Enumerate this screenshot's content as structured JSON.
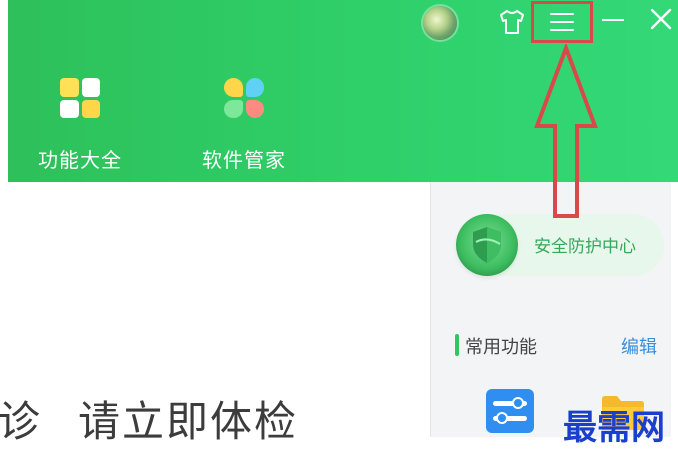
{
  "titlebar": {
    "icons": [
      "avatar",
      "skin-icon",
      "menu-icon",
      "minimize-icon",
      "close-icon"
    ]
  },
  "toolbar": {
    "items": [
      {
        "label": "功能大全",
        "icon": "apps-grid-icon",
        "colors": [
          "#ffe156",
          "#ffffff",
          "#ffffff",
          "#ffd54a"
        ]
      },
      {
        "label": "软件管家",
        "icon": "software-manager-icon",
        "colors": [
          "#ffd54a",
          "#5fd1f5",
          "#7de89a",
          "#ff8a80"
        ]
      }
    ]
  },
  "right_panel": {
    "security": {
      "label": "安全防护中心",
      "icon": "shield-icon"
    },
    "common_section": {
      "title": "常用功能",
      "edit": "编辑"
    }
  },
  "main": {
    "partial_left": "诊",
    "text": "请立即体检"
  },
  "annotation": {
    "color": "#d84a4a",
    "icon": "red-arrow-up"
  },
  "watermark": {
    "text": "最需网"
  },
  "colors": {
    "header_green": "#2fd06a",
    "accent_green": "#2fc764",
    "link_blue": "#3a8fdc"
  }
}
